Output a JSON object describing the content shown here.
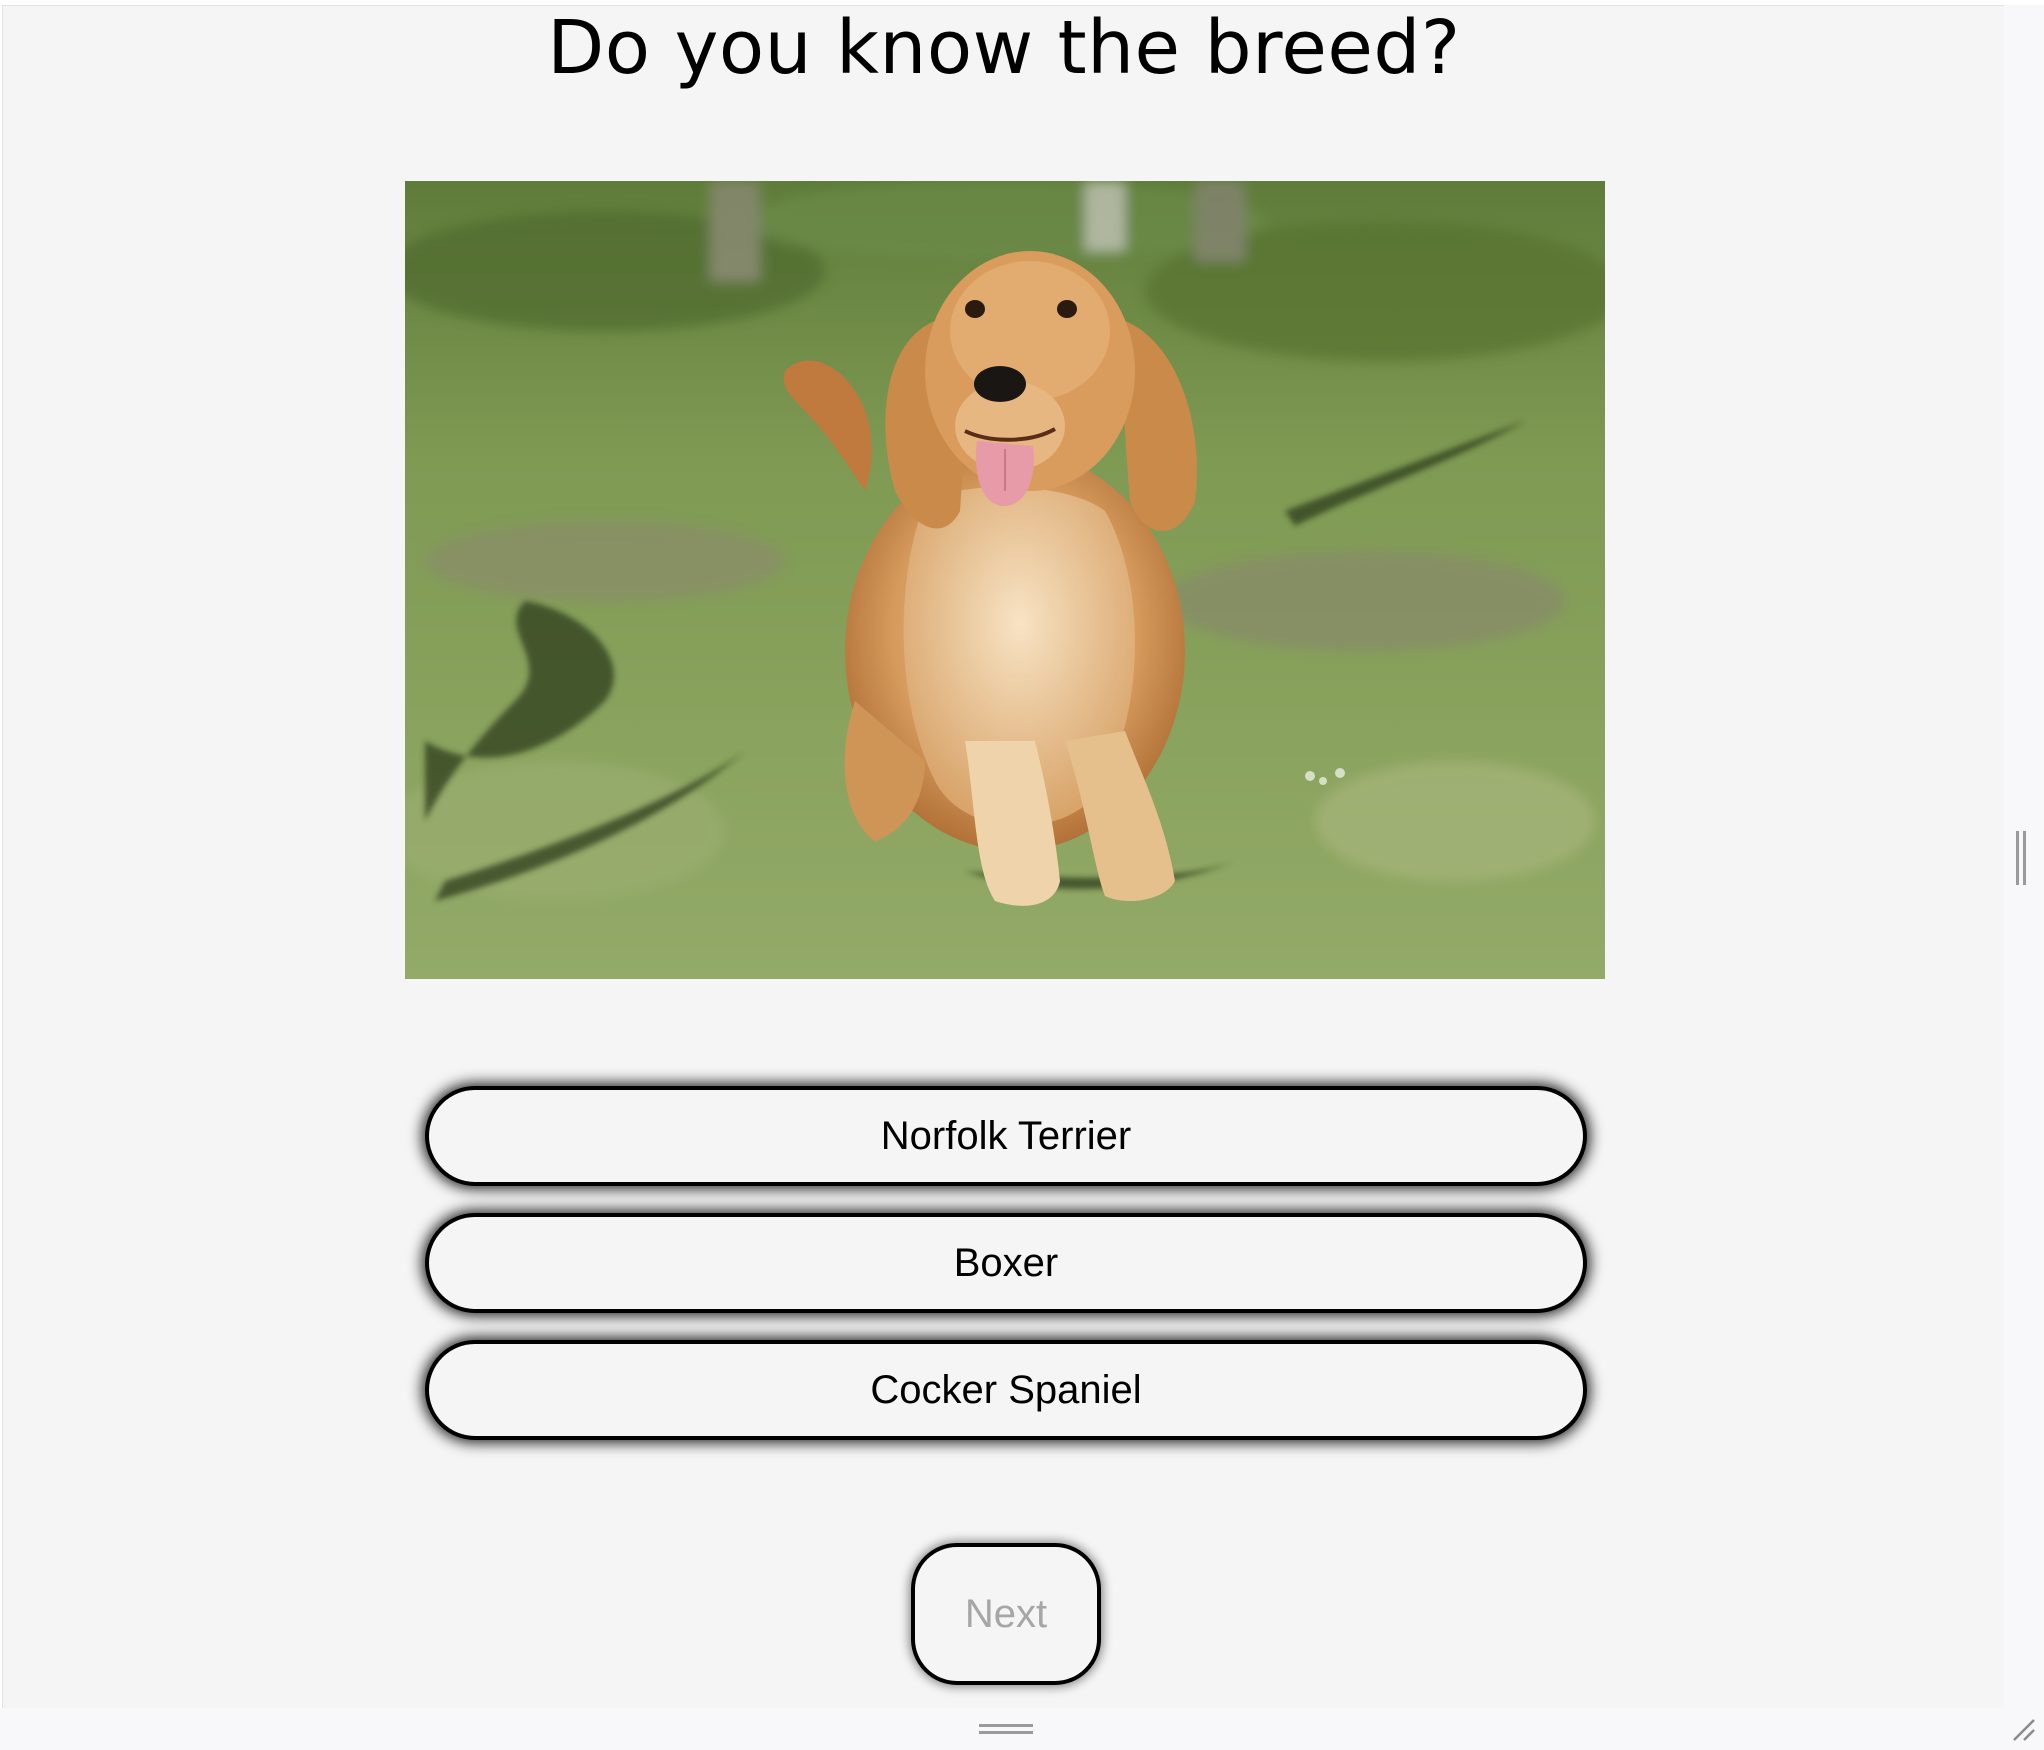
{
  "quiz": {
    "title": "Do you know the breed?",
    "answers": [
      {
        "label": "Norfolk Terrier"
      },
      {
        "label": "Boxer"
      },
      {
        "label": "Cocker Spaniel"
      }
    ],
    "next_label": "Next",
    "next_enabled": false
  },
  "icons": {
    "vertical_splitter": "drag-handle-vertical-icon",
    "horizontal_splitter": "drag-handle-horizontal-icon",
    "corner": "resize-corner-icon"
  },
  "colors": {
    "page_background": "#f5f5f5",
    "button_border": "#000000",
    "next_text_disabled": "#a6a6a6"
  }
}
